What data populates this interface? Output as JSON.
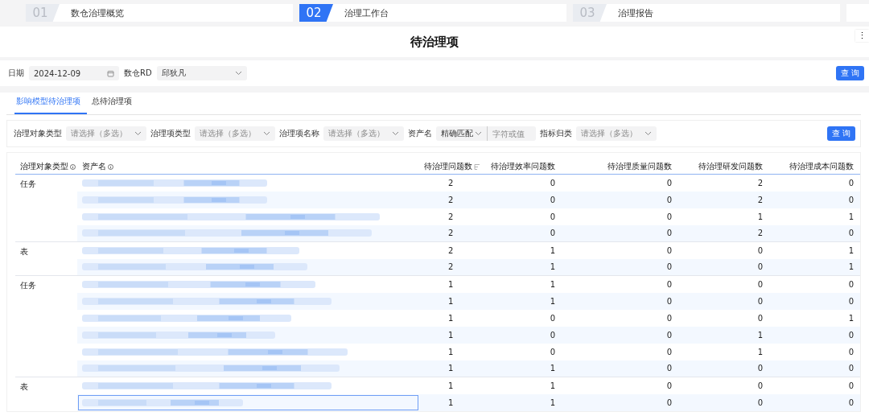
{
  "steps": [
    {
      "number": "01",
      "label": "数仓治理概览",
      "selected": false
    },
    {
      "number": "02",
      "label": "治理工作台",
      "selected": true
    },
    {
      "number": "03",
      "label": "治理报告",
      "selected": false
    }
  ],
  "page_title": "待治理项",
  "more_menu": "⋮",
  "top_filters": {
    "date_label": "日期",
    "date_value": "2024-12-09",
    "rd_label": "数仓RD",
    "rd_value": "邱狄凡",
    "query_button": "查 询"
  },
  "tabs": [
    {
      "label": "影响模型待治理项",
      "selected": true
    },
    {
      "label": "总待治理项",
      "selected": false
    }
  ],
  "filters": [
    {
      "kind": "select",
      "label": "治理对象类型",
      "placeholder": "请选择（多选）"
    },
    {
      "kind": "select",
      "label": "治理项类型",
      "placeholder": "请选择（多选）"
    },
    {
      "kind": "select",
      "label": "治理项名称",
      "placeholder": "请选择（多选）"
    },
    {
      "kind": "match",
      "label": "资产名",
      "mode": "精确匹配",
      "placeholder": "字符或值"
    },
    {
      "kind": "select",
      "label": "指标归类",
      "placeholder": "请选择（多选）"
    }
  ],
  "filter_query_button": "查 询",
  "table": {
    "columns": [
      "治理对象类型",
      "资产名",
      "待治理问题数",
      "待治理效率问题数",
      "待治理质量问题数",
      "待治理研发问题数",
      "待治理成本问题数"
    ],
    "groups": [
      {
        "type": "任务",
        "rows": [
          {
            "counts": [
              "2",
              "0",
              "0",
              "2",
              "0"
            ],
            "selected": false
          },
          {
            "counts": [
              "2",
              "0",
              "0",
              "2",
              "0"
            ],
            "selected": false
          },
          {
            "counts": [
              "2",
              "0",
              "0",
              "1",
              "1"
            ],
            "selected": false
          },
          {
            "counts": [
              "2",
              "0",
              "0",
              "2",
              "0"
            ],
            "selected": false
          }
        ]
      },
      {
        "type": "表",
        "rows": [
          {
            "counts": [
              "2",
              "1",
              "0",
              "0",
              "1"
            ],
            "selected": false
          },
          {
            "counts": [
              "2",
              "1",
              "0",
              "0",
              "1"
            ],
            "selected": false
          }
        ]
      },
      {
        "type": "任务",
        "rows": [
          {
            "counts": [
              "1",
              "1",
              "0",
              "0",
              "0"
            ],
            "selected": false
          },
          {
            "counts": [
              "1",
              "1",
              "0",
              "0",
              "0"
            ],
            "selected": false
          },
          {
            "counts": [
              "1",
              "0",
              "0",
              "0",
              "1"
            ],
            "selected": false
          },
          {
            "counts": [
              "1",
              "0",
              "0",
              "1",
              "0"
            ],
            "selected": false
          },
          {
            "counts": [
              "1",
              "0",
              "0",
              "1",
              "0"
            ],
            "selected": false
          },
          {
            "counts": [
              "1",
              "1",
              "0",
              "0",
              "0"
            ],
            "selected": false
          }
        ]
      },
      {
        "type": "表",
        "rows": [
          {
            "counts": [
              "1",
              "1",
              "0",
              "0",
              "0"
            ],
            "selected": false
          },
          {
            "counts": [
              "1",
              "1",
              "0",
              "0",
              "0"
            ],
            "selected": true
          }
        ]
      }
    ]
  }
}
